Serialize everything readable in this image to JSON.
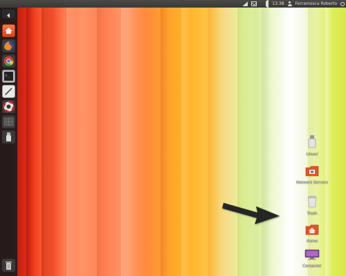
{
  "panel": {
    "time": "13:38",
    "user": "Ferramosca Roberto"
  },
  "launcher": {
    "items": [
      {
        "icon": "launcher-toggle-arrow-icon"
      },
      {
        "icon": "home-folder-icon"
      },
      {
        "icon": "firefox-icon"
      },
      {
        "icon": "chrome-icon"
      },
      {
        "icon": "terminal-icon"
      },
      {
        "icon": "text-editor-icon"
      },
      {
        "icon": "lifebuoy-help-icon"
      },
      {
        "icon": "workspace-switcher-icon"
      },
      {
        "icon": "usb-drive-icon"
      },
      {
        "icon": "trash-icon"
      }
    ]
  },
  "desktop": {
    "icons": [
      {
        "label": "Linux/",
        "icon": "usb-drive-icon"
      },
      {
        "label": "Network Servers",
        "icon": "network-folder-icon"
      },
      {
        "label": "Trash",
        "icon": "trash-icon"
      },
      {
        "label": "Home",
        "icon": "home-folder-icon"
      },
      {
        "label": "Computer",
        "icon": "computer-icon"
      }
    ]
  },
  "colors": {
    "panel": "#3c3b37",
    "launcher": "#1c1c1c",
    "orange": "#e0552a",
    "arrow": "#2a2a2a"
  }
}
